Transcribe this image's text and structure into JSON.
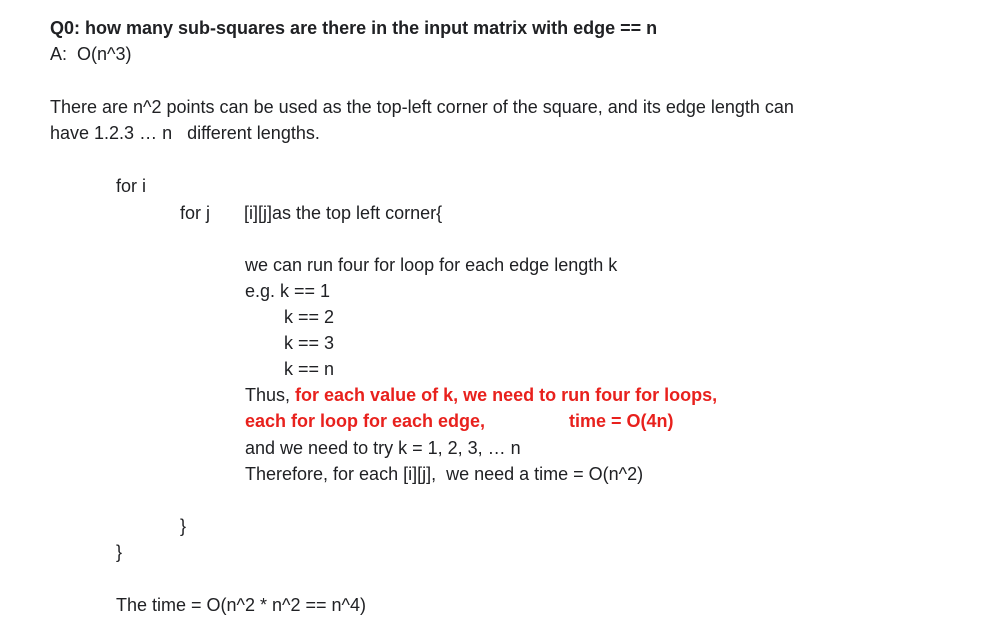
{
  "question": {
    "title": "Q0: how many sub-squares are there in the input matrix with edge == n",
    "answer": "A:  O(n^3)"
  },
  "explanation": {
    "line1": "There are n^2 points can be used as the top-left corner of the square, and its edge length can",
    "line2": "have 1.2.3 … n   different lengths."
  },
  "code": {
    "for_i": "for i",
    "for_j": "for j",
    "corner": "[i][j]as the top left corner{",
    "loop_desc": "we can run four for loop for each edge length k",
    "eg_k1": "e.g. k == 1",
    "k2": "k == 2",
    "k3": "k == 3",
    "kn": "k == n",
    "thus_prefix": "Thus,",
    "thus_red": " for each value of k, we need to run four for loops,",
    "each_edge": "each for loop for each edge,",
    "time_4n": "time = O(4n)",
    "try_k": "and we need to try k = 1, 2, 3, … n",
    "therefore": "Therefore, for each [i][j],  we need a time = O(n^2)",
    "close_inner": "}",
    "close_outer": "}"
  },
  "conclusion": {
    "total_time": "The time = O(n^2 * n^2 == n^4)"
  }
}
